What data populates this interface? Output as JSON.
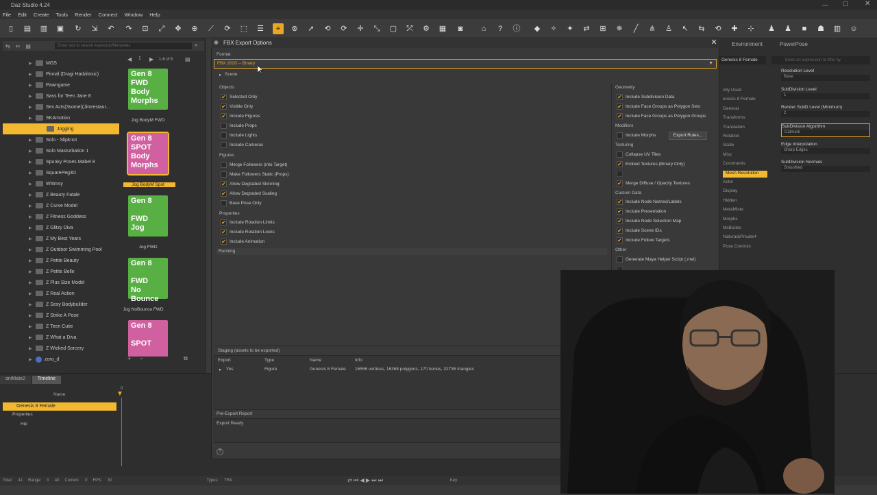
{
  "app": {
    "title": "Daz Studio 4.24"
  },
  "menu": [
    "File",
    "Edit",
    "Create",
    "Tools",
    "Render",
    "Connect",
    "Window",
    "Help"
  ],
  "content_library": {
    "search_placeholder": "Enter text to search keywords/filenames",
    "page_info": "1-6 of 6",
    "tree": [
      {
        "label": "MGS",
        "sel": false
      },
      {
        "label": "Pinnal (Dragi Hadzitosic)",
        "sel": false
      },
      {
        "label": "Pawngame",
        "sel": false
      },
      {
        "label": "Sass for Teen Jane 8",
        "sel": false
      },
      {
        "label": "Sex Acts(3some)(Jimrestaur...",
        "sel": false
      },
      {
        "label": "SKAmotion",
        "sel": false
      },
      {
        "label": "Jogging",
        "sel": true
      },
      {
        "label": "Solo - Slipknot",
        "sel": false
      },
      {
        "label": "Solo Masturbation 1",
        "sel": false
      },
      {
        "label": "Spunky Poses Mabel 8",
        "sel": false
      },
      {
        "label": "SquarePeg3D",
        "sel": false
      },
      {
        "label": "Whimsy",
        "sel": false
      },
      {
        "label": "Z Beauty Fatale",
        "sel": false
      },
      {
        "label": "Z Curve Model",
        "sel": false
      },
      {
        "label": "Z Fitness Goddess",
        "sel": false
      },
      {
        "label": "Z Glitzy Diva",
        "sel": false
      },
      {
        "label": "Z My Best Years",
        "sel": false
      },
      {
        "label": "Z Outdoor Swimming Pool",
        "sel": false
      },
      {
        "label": "Z Petite Beauty",
        "sel": false
      },
      {
        "label": "Z Petite Belle",
        "sel": false
      },
      {
        "label": "Z Plus Size Model",
        "sel": false
      },
      {
        "label": "Z Real Action",
        "sel": false
      },
      {
        "label": "Z Sexy Bodybuilder",
        "sel": false
      },
      {
        "label": "Z Strike A Pose",
        "sel": false
      },
      {
        "label": "Z Teen Cutie",
        "sel": false
      },
      {
        "label": "Z What a Diva",
        "sel": false
      },
      {
        "label": "Z Wicked Sorcery",
        "sel": false
      },
      {
        "label": "zoro_d",
        "sel": false
      }
    ],
    "thumbnails": [
      {
        "lines": [
          "Gen 8",
          "FWD",
          "Body",
          "Morphs"
        ],
        "label": "Jog BodyM FWD",
        "color": "green",
        "sel": false
      },
      {
        "lines": [
          "Gen 8",
          "SPOT",
          "Body",
          "Morphs"
        ],
        "label": "Jog BodyM Spot",
        "color": "pink",
        "sel": true
      },
      {
        "lines": [
          "Gen 8",
          "",
          "FWD",
          "Jog"
        ],
        "label": "Jog FWD",
        "color": "green",
        "sel": false
      },
      {
        "lines": [
          "Gen 8",
          "",
          "FWD",
          "No Bounce"
        ],
        "label": "Jog NoBounce FWD",
        "color": "green",
        "sel": false
      },
      {
        "lines": [
          "Gen 8",
          "",
          "SPOT",
          ""
        ],
        "label": "",
        "color": "pink",
        "sel": false
      }
    ]
  },
  "timeline": {
    "tabs": [
      "aniMate2",
      "Timeline"
    ],
    "name_header": "Name",
    "items": [
      "Genesis 8 Female",
      "Properties",
      "Hip"
    ],
    "frame": "0"
  },
  "statusbar": {
    "total_label": "Total:",
    "total": "41",
    "range_label": "Range:",
    "range_start": "0",
    "range_end": "40",
    "current_label": "Current:",
    "current": "0",
    "fps_label": "FPS:",
    "fps": "30",
    "types_label": "Types:",
    "types": "TRA",
    "keys_label": "Key"
  },
  "right_panel": {
    "tabs": [
      "Environment",
      "PowerPose"
    ],
    "node": "Genesis 8 Female",
    "filter_placeholder": "Enter an expression to filter by",
    "groups": [
      "ntly Used",
      "enesis 8 Female",
      "General",
      "Transforms",
      "Translation",
      "Rotation",
      "Scale",
      "Misc",
      "Constraints",
      "Mesh Resolution",
      "Actor",
      "Display",
      "Hidden",
      "MetaMixer",
      "Morphs",
      "MsBoobs",
      "Natural&Private4",
      "Pose Controls"
    ],
    "selected_group": "Mesh Resolution",
    "properties": [
      {
        "label": "Resolution Level",
        "value": "Base"
      },
      {
        "label": "SubDivision Level",
        "value": "1"
      },
      {
        "label": "Render SubD Level (Minimum)",
        "value": "2"
      },
      {
        "label": "SubDivision Algorithm",
        "value": "Catmark"
      },
      {
        "label": "Edge Interpolation",
        "value": "Sharp Edges"
      },
      {
        "label": "SubDivision Normals",
        "value": "Smoothed"
      }
    ]
  },
  "dialog": {
    "title": "FBX Export Options",
    "format_label": "Format",
    "format_value": "FBX 2020 -- Binary",
    "scene_label": "Scene",
    "objects": {
      "heading": "Objects",
      "items": [
        {
          "label": "Selected Only",
          "checked": true
        },
        {
          "label": "Visible Only",
          "checked": true
        },
        {
          "label": "Include Figures",
          "checked": true
        },
        {
          "label": "Include Props",
          "checked": false
        },
        {
          "label": "Include Lights",
          "checked": false
        },
        {
          "label": "Include Cameras",
          "checked": false
        }
      ]
    },
    "figures": {
      "heading": "Figures",
      "items": [
        {
          "label": "Merge Followers (into Target)",
          "checked": false
        },
        {
          "label": "Make Followers Static (Props)",
          "checked": false
        },
        {
          "label": "Allow Degraded Skinning",
          "checked": true
        },
        {
          "label": "Allow Degraded Scaling",
          "checked": true
        },
        {
          "label": "Base Pose Only",
          "checked": false
        }
      ]
    },
    "properties": {
      "heading": "Properties",
      "items": [
        {
          "label": "Include Rotation Limits",
          "checked": true
        },
        {
          "label": "Include Rotation Locks",
          "checked": true
        },
        {
          "label": "Include Animation",
          "checked": true
        }
      ]
    },
    "running_label": "Running",
    "geometry": {
      "heading": "Geometry",
      "items": [
        {
          "label": "Include Subdivision Data",
          "checked": true
        },
        {
          "label": "Include Face Groups as Polygon Sets",
          "checked": true
        },
        {
          "label": "Include Face Groups as Polygon Groups",
          "checked": true
        }
      ]
    },
    "modifiers": {
      "heading": "Modifiers",
      "include_morphs": "Include Morphs",
      "export_rules": "Export Rules..."
    },
    "texturing": {
      "heading": "Texturing",
      "items": [
        {
          "label": "Collapse UV Tiles",
          "checked": false
        },
        {
          "label": "Embed Textures (Binary Only)",
          "checked": true
        },
        {
          "label": "Merge Diffuse / Opacity Textures",
          "checked": true
        }
      ]
    },
    "custom_data": {
      "heading": "Custom Data",
      "items": [
        {
          "label": "Include Node Names/Labels",
          "checked": true
        },
        {
          "label": "Include Presentation",
          "checked": true
        },
        {
          "label": "Include Node Selection Map",
          "checked": true
        },
        {
          "label": "Include Scene IDs",
          "checked": true
        },
        {
          "label": "Include Follow Targets",
          "checked": true
        }
      ]
    },
    "other": {
      "heading": "Other",
      "items": [
        {
          "label": "Generate Maya Helper Script (.mel)",
          "checked": false
        }
      ]
    },
    "staging": {
      "heading": "Staging (assets to be exported)",
      "columns": [
        "Export",
        "Type",
        "Name",
        "Info"
      ],
      "row": {
        "export": "Yes",
        "type": "Figure",
        "name": "Genesis 8 Female",
        "info": "16556 vertices, 16368 polygons, 170 bones, 32736 triangles"
      }
    },
    "pre_export": {
      "heading": "Pre-Export Report",
      "text": "Export Ready"
    },
    "help_icon": "?"
  }
}
